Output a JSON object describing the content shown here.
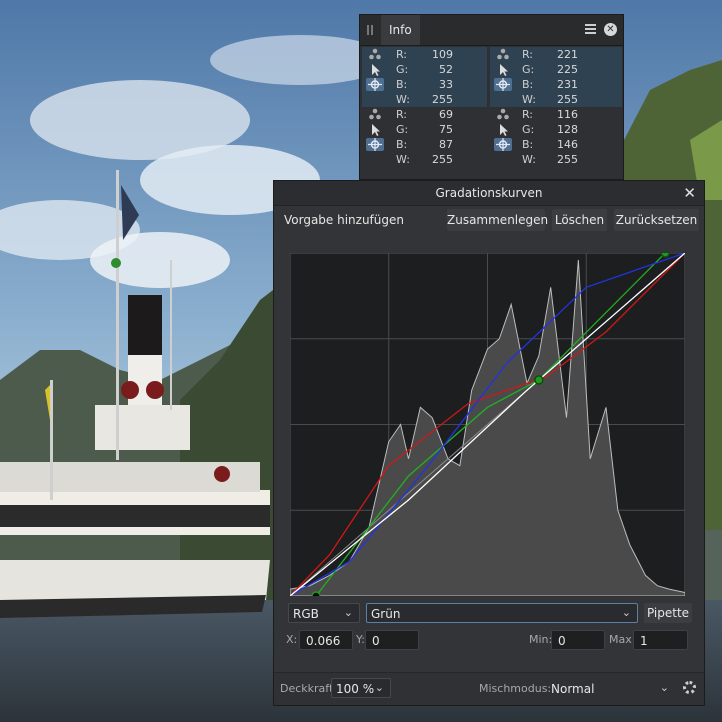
{
  "info_panel": {
    "tab": "Info",
    "rows": [
      [
        {
          "ch": "R:",
          "v": "109"
        },
        {
          "ch": "R:",
          "v": "221"
        }
      ],
      [
        {
          "ch": "G:",
          "v": "52"
        },
        {
          "ch": "G:",
          "v": "225"
        }
      ],
      [
        {
          "ch": "B:",
          "v": "33"
        },
        {
          "ch": "B:",
          "v": "231"
        }
      ],
      [
        {
          "ch": "W:",
          "v": "255"
        },
        {
          "ch": "W:",
          "v": "255"
        }
      ],
      [
        {
          "ch": "R:",
          "v": "69"
        },
        {
          "ch": "R:",
          "v": "116"
        }
      ],
      [
        {
          "ch": "G:",
          "v": "75"
        },
        {
          "ch": "G:",
          "v": "128"
        }
      ],
      [
        {
          "ch": "B:",
          "v": "87"
        },
        {
          "ch": "B:",
          "v": "146"
        }
      ],
      [
        {
          "ch": "W:",
          "v": "255"
        },
        {
          "ch": "W:",
          "v": "255"
        }
      ]
    ],
    "icons": [
      "sample-dots-icon",
      "pointer-icon",
      "crosshair-target-icon",
      "",
      "sample-dots-icon",
      "pointer-icon",
      "crosshair-target-icon",
      ""
    ]
  },
  "curves_dialog": {
    "title": "Gradationskurven",
    "buttons": {
      "add_preset": "Vorgabe hinzufügen",
      "merge": "Zusammenlegen",
      "delete": "Löschen",
      "reset": "Zurücksetzen"
    },
    "color_space": "RGB",
    "channel": "Grün",
    "picker": "Pipette",
    "x_label": "X:",
    "x_value": "0.066",
    "y_label": "Y:",
    "y_value": "0",
    "min_label": "Min:",
    "min_value": "0",
    "max_label": "Max:",
    "max_value": "1",
    "opacity_label": "Deckkraft:",
    "opacity_value": "100 %",
    "blend_label": "Mischmodus:",
    "blend_value": "Normal"
  },
  "chart_data": {
    "type": "line",
    "xlim": [
      0,
      1
    ],
    "ylim": [
      0,
      1
    ],
    "grid": true,
    "curve_colors": {
      "red": "#d01818",
      "green": "#22b022",
      "blue": "#2233e0",
      "master": "#ffffff"
    },
    "series": [
      {
        "x": [
          0,
          0.1,
          0.25,
          0.45,
          0.65,
          0.8,
          1
        ],
        "values": [
          0,
          0.12,
          0.38,
          0.56,
          0.64,
          0.77,
          1
        ]
      },
      {
        "x": [
          0.066,
          0.3,
          0.5,
          0.63,
          0.95
        ],
        "values": [
          0,
          0.35,
          0.55,
          0.63,
          1
        ]
      },
      {
        "x": [
          0,
          0.15,
          0.35,
          0.55,
          0.75,
          1
        ],
        "values": [
          0,
          0.1,
          0.38,
          0.68,
          0.9,
          1
        ]
      },
      {
        "x": [
          0,
          0.3,
          0.6,
          1
        ],
        "values": [
          0,
          0.28,
          0.6,
          1
        ]
      }
    ],
    "histogram": {
      "x": [
        0,
        0.05,
        0.1,
        0.15,
        0.2,
        0.25,
        0.28,
        0.3,
        0.33,
        0.36,
        0.4,
        0.43,
        0.46,
        0.5,
        0.53,
        0.56,
        0.6,
        0.63,
        0.66,
        0.7,
        0.73,
        0.76,
        0.8,
        0.83,
        0.86,
        0.9,
        0.93,
        0.96,
        1
      ],
      "values": [
        0.02,
        0.03,
        0.06,
        0.1,
        0.2,
        0.45,
        0.5,
        0.4,
        0.55,
        0.52,
        0.4,
        0.38,
        0.6,
        0.72,
        0.75,
        0.85,
        0.62,
        0.7,
        0.9,
        0.52,
        0.98,
        0.4,
        0.55,
        0.25,
        0.15,
        0.06,
        0.03,
        0.02,
        0.01
      ]
    },
    "control_points": [
      {
        "x": 0.066,
        "y": 0
      },
      {
        "x": 0.63,
        "y": 0.63
      },
      {
        "x": 0.95,
        "y": 1
      }
    ]
  }
}
